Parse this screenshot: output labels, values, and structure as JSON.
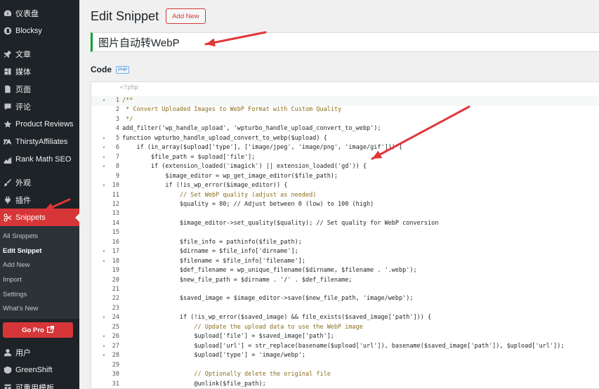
{
  "sidebar": {
    "items_top": [
      {
        "label": "仪表盘",
        "icon": "dashboard-icon"
      },
      {
        "label": "Blocksy",
        "icon": "blocksy-icon"
      }
    ],
    "items_mid": [
      {
        "label": "文章",
        "icon": "pin-icon"
      },
      {
        "label": "媒体",
        "icon": "media-icon"
      },
      {
        "label": "页面",
        "icon": "page-icon"
      },
      {
        "label": "评论",
        "icon": "comment-icon"
      },
      {
        "label": "Product Reviews",
        "icon": "star-icon"
      },
      {
        "label": "ThirstyAffiliates",
        "icon": "ta-icon"
      },
      {
        "label": "Rank Math SEO",
        "icon": "rankmath-icon"
      }
    ],
    "items_low": [
      {
        "label": "外观",
        "icon": "brush-icon"
      },
      {
        "label": "插件",
        "icon": "plugin-icon"
      }
    ],
    "active_item": {
      "label": "Snippets",
      "icon": "scissors-icon"
    },
    "submenu": [
      "All Snippets",
      "Edit Snippet",
      "Add New",
      "Import",
      "Settings",
      "What's New"
    ],
    "submenu_current": "Edit Snippet",
    "go_pro_label": "Go Pro",
    "items_bottom": [
      {
        "label": "用户",
        "icon": "user-icon"
      },
      {
        "label": "GreenShift",
        "icon": "greenshift-icon"
      },
      {
        "label": "可重用模板",
        "icon": "template-icon"
      }
    ]
  },
  "main": {
    "page_title": "Edit Snippet",
    "add_new_label": "Add New",
    "snippet_title": "图片自动转WebP",
    "code_label": "Code",
    "code_language_badge": "PHP",
    "php_open_tag": "<?php"
  },
  "code_lines": [
    {
      "n": "1",
      "fold": true,
      "text": "/**",
      "kind": "cmt"
    },
    {
      "n": "2",
      "fold": false,
      "text": " * Convert Uploaded Images to WebP Format with Custom Quality",
      "kind": "cmt"
    },
    {
      "n": "3",
      "fold": false,
      "text": " */",
      "kind": "cmt"
    },
    {
      "n": "4",
      "fold": false,
      "text": "add_filter('wp_handle_upload', 'wpturbo_handle_upload_convert_to_webp');",
      "kind": "code"
    },
    {
      "n": "5",
      "fold": true,
      "text": "function wpturbo_handle_upload_convert_to_webp($upload) {",
      "kind": "code"
    },
    {
      "n": "6",
      "fold": true,
      "text": "    if (in_array($upload['type'], ['image/jpeg', 'image/png', 'image/gif'])) {",
      "kind": "code"
    },
    {
      "n": "7",
      "fold": true,
      "text": "        $file_path = $upload['file'];",
      "kind": "code"
    },
    {
      "n": "8",
      "fold": true,
      "text": "        if (extension_loaded('imagick') || extension_loaded('gd')) {",
      "kind": "code"
    },
    {
      "n": "9",
      "fold": false,
      "text": "            $image_editor = wp_get_image_editor($file_path);",
      "kind": "code"
    },
    {
      "n": "10",
      "fold": true,
      "text": "            if (!is_wp_error($image_editor)) {",
      "kind": "code"
    },
    {
      "n": "11",
      "fold": false,
      "text": "                // Set WebP quality (adjust as needed)",
      "kind": "cmt"
    },
    {
      "n": "12",
      "fold": false,
      "text": "                $quality = 80; // Adjust between 0 (low) to 100 (high)",
      "kind": "code"
    },
    {
      "n": "13",
      "fold": false,
      "text": "",
      "kind": "code"
    },
    {
      "n": "14",
      "fold": false,
      "text": "                $image_editor->set_quality($quality); // Set quality for WebP conversion",
      "kind": "code"
    },
    {
      "n": "15",
      "fold": false,
      "text": "",
      "kind": "code"
    },
    {
      "n": "16",
      "fold": false,
      "text": "                $file_info = pathinfo($file_path);",
      "kind": "code"
    },
    {
      "n": "17",
      "fold": true,
      "text": "                $dirname = $file_info['dirname'];",
      "kind": "code"
    },
    {
      "n": "18",
      "fold": true,
      "text": "                $filename = $file_info['filename'];",
      "kind": "code"
    },
    {
      "n": "19",
      "fold": false,
      "text": "                $def_filename = wp_unique_filename($dirname, $filename . '.webp');",
      "kind": "code"
    },
    {
      "n": "20",
      "fold": false,
      "text": "                $new_file_path = $dirname . '/' . $def_filename;",
      "kind": "code"
    },
    {
      "n": "21",
      "fold": false,
      "text": "",
      "kind": "code"
    },
    {
      "n": "22",
      "fold": false,
      "text": "                $saved_image = $image_editor->save($new_file_path, 'image/webp');",
      "kind": "code"
    },
    {
      "n": "23",
      "fold": false,
      "text": "",
      "kind": "code"
    },
    {
      "n": "24",
      "fold": true,
      "text": "                if (!is_wp_error($saved_image) && file_exists($saved_image['path'])) {",
      "kind": "code"
    },
    {
      "n": "25",
      "fold": false,
      "text": "                    // Update the upload data to use the WebP image",
      "kind": "cmt"
    },
    {
      "n": "26",
      "fold": true,
      "text": "                    $upload['file'] = $saved_image['path'];",
      "kind": "code"
    },
    {
      "n": "27",
      "fold": true,
      "text": "                    $upload['url'] = str_replace(basename($upload['url']), basename($saved_image['path']), $upload['url']);",
      "kind": "code"
    },
    {
      "n": "28",
      "fold": true,
      "text": "                    $upload['type'] = 'image/webp';",
      "kind": "code"
    },
    {
      "n": "29",
      "fold": false,
      "text": "",
      "kind": "code"
    },
    {
      "n": "30",
      "fold": false,
      "text": "                    // Optionally delete the original file",
      "kind": "cmt"
    },
    {
      "n": "31",
      "fold": false,
      "text": "                    @unlink($file_path);",
      "kind": "code"
    }
  ],
  "colors": {
    "sidebar_bg": "#1d2327",
    "accent_red": "#d63638",
    "title_border_green": "#00a32a",
    "arrow_red": "#e0363a"
  }
}
